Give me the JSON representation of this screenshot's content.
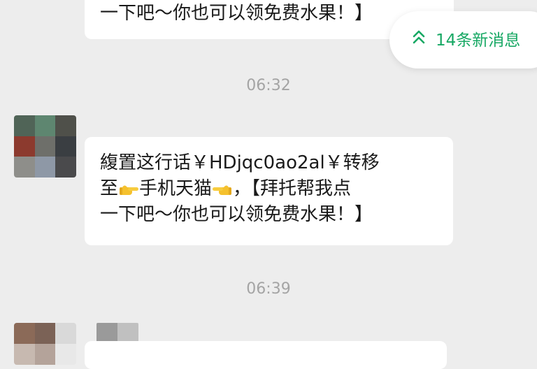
{
  "accent_color": "#17a864",
  "new_messages": {
    "icon": "double-chevron-up-icon",
    "label": "14条新消息"
  },
  "messages": [
    {
      "lines": [
        "一下吧～你也可以领免费水果！】"
      ]
    },
    {
      "time": "06:32",
      "lines": [
        "緮置这行话￥HDjqc0ao2al￥转移",
        [
          "至",
          "pointing-right-hand-emoji",
          "手机天猫",
          "pointing-left-hand-emoji",
          "，【拜托帮我点"
        ],
        "一下吧～你也可以领免费水果！】"
      ],
      "line2_parts": {
        "a": "至",
        "b": "手机天猫",
        "c": "，【拜托帮我点"
      }
    },
    {
      "time": "06:39"
    }
  ],
  "avatar_colors": {
    "avatar_1": [
      "#506457",
      "#5e8670",
      "#4f504a",
      "#8c3a2e",
      "#6e6f6a",
      "#3a3e42",
      "#8e8e8a",
      "#8e98a6",
      "#4a4a4c"
    ],
    "avatar_2": [
      "#8b6a58",
      "#7b6256",
      "#d9d9d9",
      "#c7b9b0",
      "#b4a39a",
      "#e8e8e8"
    ],
    "nickname": [
      "#9a9a9a",
      "#c0c0c0"
    ]
  }
}
